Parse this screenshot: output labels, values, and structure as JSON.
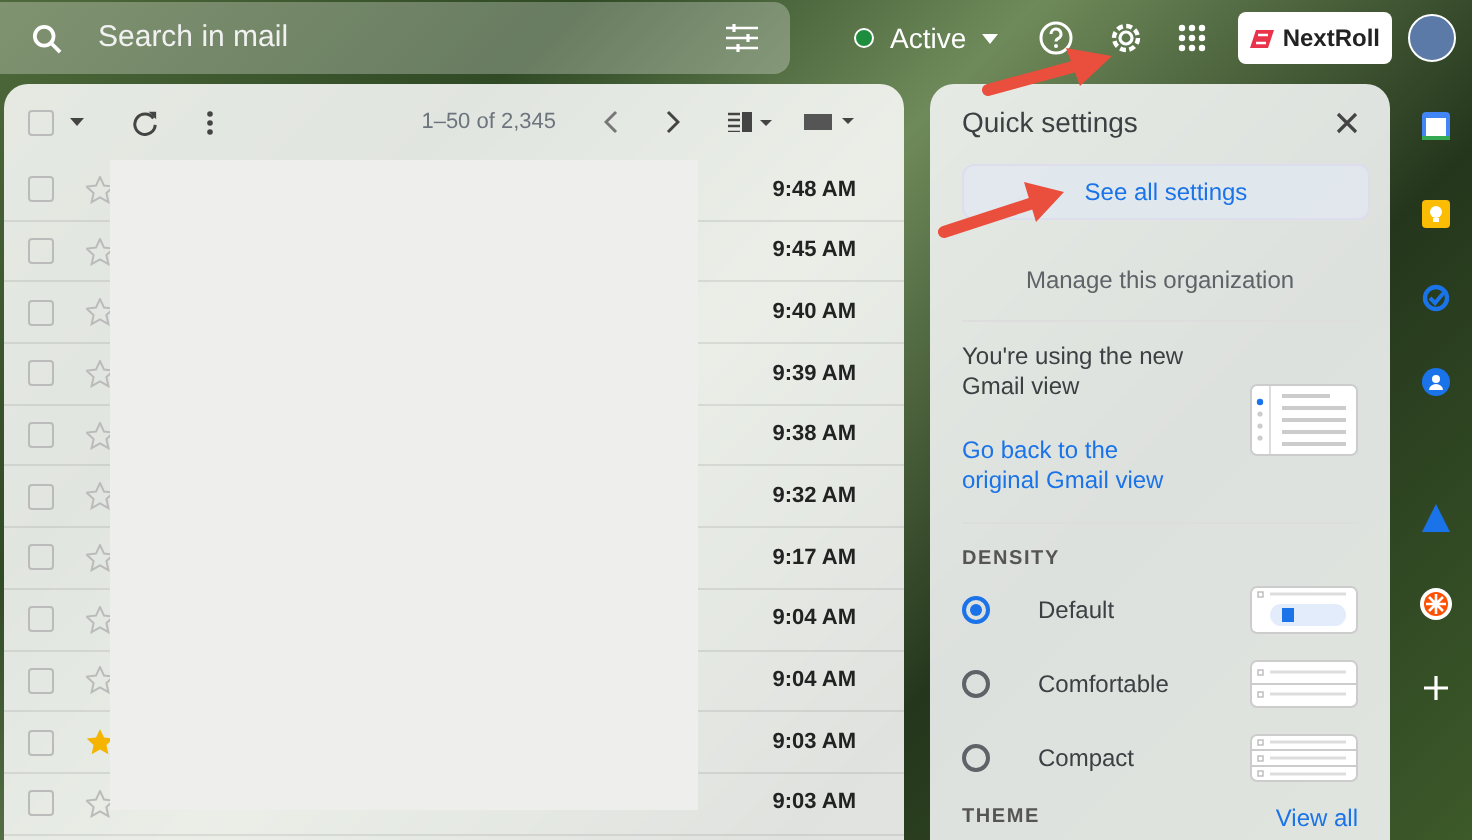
{
  "search": {
    "placeholder": "Search in mail"
  },
  "status": {
    "label": "Active"
  },
  "brand": {
    "label": "NextRoll"
  },
  "toolbar": {
    "select_all_checked": false,
    "page_range": "1–50 of 2,345"
  },
  "messages": [
    {
      "checked": false,
      "starred": false,
      "time": "9:48 AM"
    },
    {
      "checked": false,
      "starred": false,
      "time": "9:45 AM"
    },
    {
      "checked": false,
      "starred": false,
      "time": "9:40 AM"
    },
    {
      "checked": false,
      "starred": false,
      "time": "9:39 AM"
    },
    {
      "checked": false,
      "starred": false,
      "time": "9:38 AM"
    },
    {
      "checked": false,
      "starred": false,
      "time": "9:32 AM"
    },
    {
      "checked": false,
      "starred": false,
      "time": "9:17 AM"
    },
    {
      "checked": false,
      "starred": false,
      "time": "9:04 AM"
    },
    {
      "checked": false,
      "starred": false,
      "time": "9:04 AM"
    },
    {
      "checked": false,
      "starred": true,
      "time": "9:03 AM"
    },
    {
      "checked": false,
      "starred": false,
      "time": "9:03 AM"
    }
  ],
  "quick_settings": {
    "title": "Quick settings",
    "see_all": "See all settings",
    "manage": "Manage this organization",
    "new_view_text": "You're using the new Gmail view",
    "go_back_link": "Go back to the original Gmail view",
    "density_heading": "DENSITY",
    "density_options": [
      {
        "label": "Default",
        "selected": true,
        "kind": "default"
      },
      {
        "label": "Comfortable",
        "selected": false,
        "kind": "comfortable"
      },
      {
        "label": "Compact",
        "selected": false,
        "kind": "compact"
      }
    ],
    "theme_heading": "THEME",
    "view_all": "View all"
  }
}
